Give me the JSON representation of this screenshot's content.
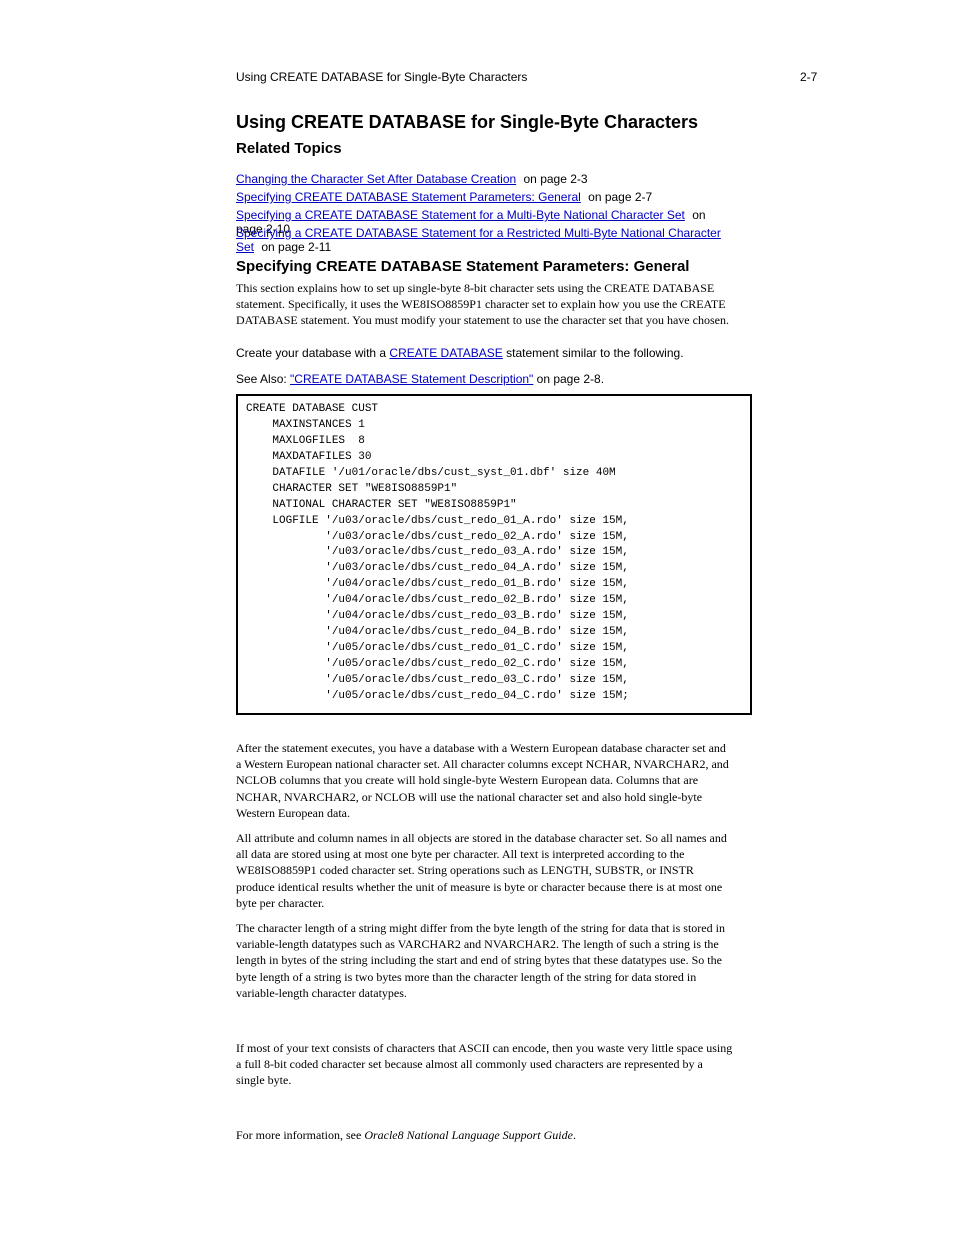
{
  "header": {
    "running": "Using CREATE DATABASE for Single-Byte Characters",
    "page": "2-7"
  },
  "titles": {
    "main": "Using CREATE DATABASE for Single-Byte Characters",
    "related": "Related Topics",
    "task": "Specifying CREATE DATABASE Statement Parameters: General"
  },
  "links": {
    "row1": [
      {
        "text": "Changing the Character Set After Database Creation",
        "href": "#"
      },
      {
        "text": " on page 2-3"
      }
    ],
    "row2": [
      {
        "text": "Specifying CREATE DATABASE Statement Parameters: General",
        "href": "#"
      },
      {
        "text": " on page 2-7"
      }
    ],
    "row3": [
      {
        "text": "Specifying a CREATE DATABASE Statement for a Multi-Byte National Character Set",
        "href": "#"
      },
      {
        "text": " on page 2-10"
      }
    ],
    "row4": [
      {
        "text": "Specifying a CREATE DATABASE Statement for a Restricted Multi-Byte National Character Set",
        "href": "#"
      },
      {
        "text": " on page 2-11"
      }
    ]
  },
  "para1": "This section explains how to set up single-byte 8-bit character sets using the CREATE DATABASE statement. Specifically, it uses the WE8ISO8859P1 character set to explain how you use the CREATE DATABASE statement. You must modify your statement to use the character set that you have chosen.",
  "create_sentence_prefix": "Create your database with a ",
  "create_link": "CREATE DATABASE",
  "create_sentence_suffix": " statement similar to the following.",
  "see_prefix": "See Also: ",
  "see_link": "\"CREATE DATABASE Statement Description\"",
  "see_suffix": " on page 2-8.",
  "code": "CREATE DATABASE CUST\n    MAXINSTANCES 1\n    MAXLOGFILES  8\n    MAXDATAFILES 30\n    DATAFILE '/u01/oracle/dbs/cust_syst_01.dbf' size 40M\n    CHARACTER SET \"WE8ISO8859P1\"\n    NATIONAL CHARACTER SET \"WE8ISO8859P1\"\n    LOGFILE '/u03/oracle/dbs/cust_redo_01_A.rdo' size 15M,\n            '/u03/oracle/dbs/cust_redo_02_A.rdo' size 15M,\n            '/u03/oracle/dbs/cust_redo_03_A.rdo' size 15M,\n            '/u03/oracle/dbs/cust_redo_04_A.rdo' size 15M,\n            '/u04/oracle/dbs/cust_redo_01_B.rdo' size 15M,\n            '/u04/oracle/dbs/cust_redo_02_B.rdo' size 15M,\n            '/u04/oracle/dbs/cust_redo_03_B.rdo' size 15M,\n            '/u04/oracle/dbs/cust_redo_04_B.rdo' size 15M,\n            '/u05/oracle/dbs/cust_redo_01_C.rdo' size 15M,\n            '/u05/oracle/dbs/cust_redo_02_C.rdo' size 15M,\n            '/u05/oracle/dbs/cust_redo_03_C.rdo' size 15M,\n            '/u05/oracle/dbs/cust_redo_04_C.rdo' size 15M;",
  "para2": "After the statement executes, you have a database with a Western European database character set and a Western European national character set. All character columns except NCHAR, NVARCHAR2, and NCLOB columns that you create will hold single-byte Western European data. Columns that are NCHAR, NVARCHAR2, or NCLOB will use the national character set and also hold single-byte Western European data.",
  "para3": "All attribute and column names in all objects are stored in the database character set. So all names and all data are stored using at most one byte per character. All text is interpreted according to the WE8ISO8859P1 coded character set. String operations such as LENGTH, SUBSTR, or INSTR produce identical results whether the unit of measure is byte or character because there is at most one byte per character.",
  "para4": "The character length of a string might differ from the byte length of the string for data that is stored in variable-length datatypes such as VARCHAR2 and NVARCHAR2. The length of such a string is the length in bytes of the string including the start and end of string bytes that these datatypes use. So the byte length of a string is two bytes more than the character length of the string for data stored in variable-length character datatypes.",
  "para5": "If most of your text consists of characters that ASCII can encode, then you waste very little space using a full 8-bit coded character set because almost all commonly used characters are represented by a single byte.",
  "footer": {
    "prefix": "For more information, see ",
    "book": "Oracle8 National Language Support Guide",
    "suffix": "."
  }
}
